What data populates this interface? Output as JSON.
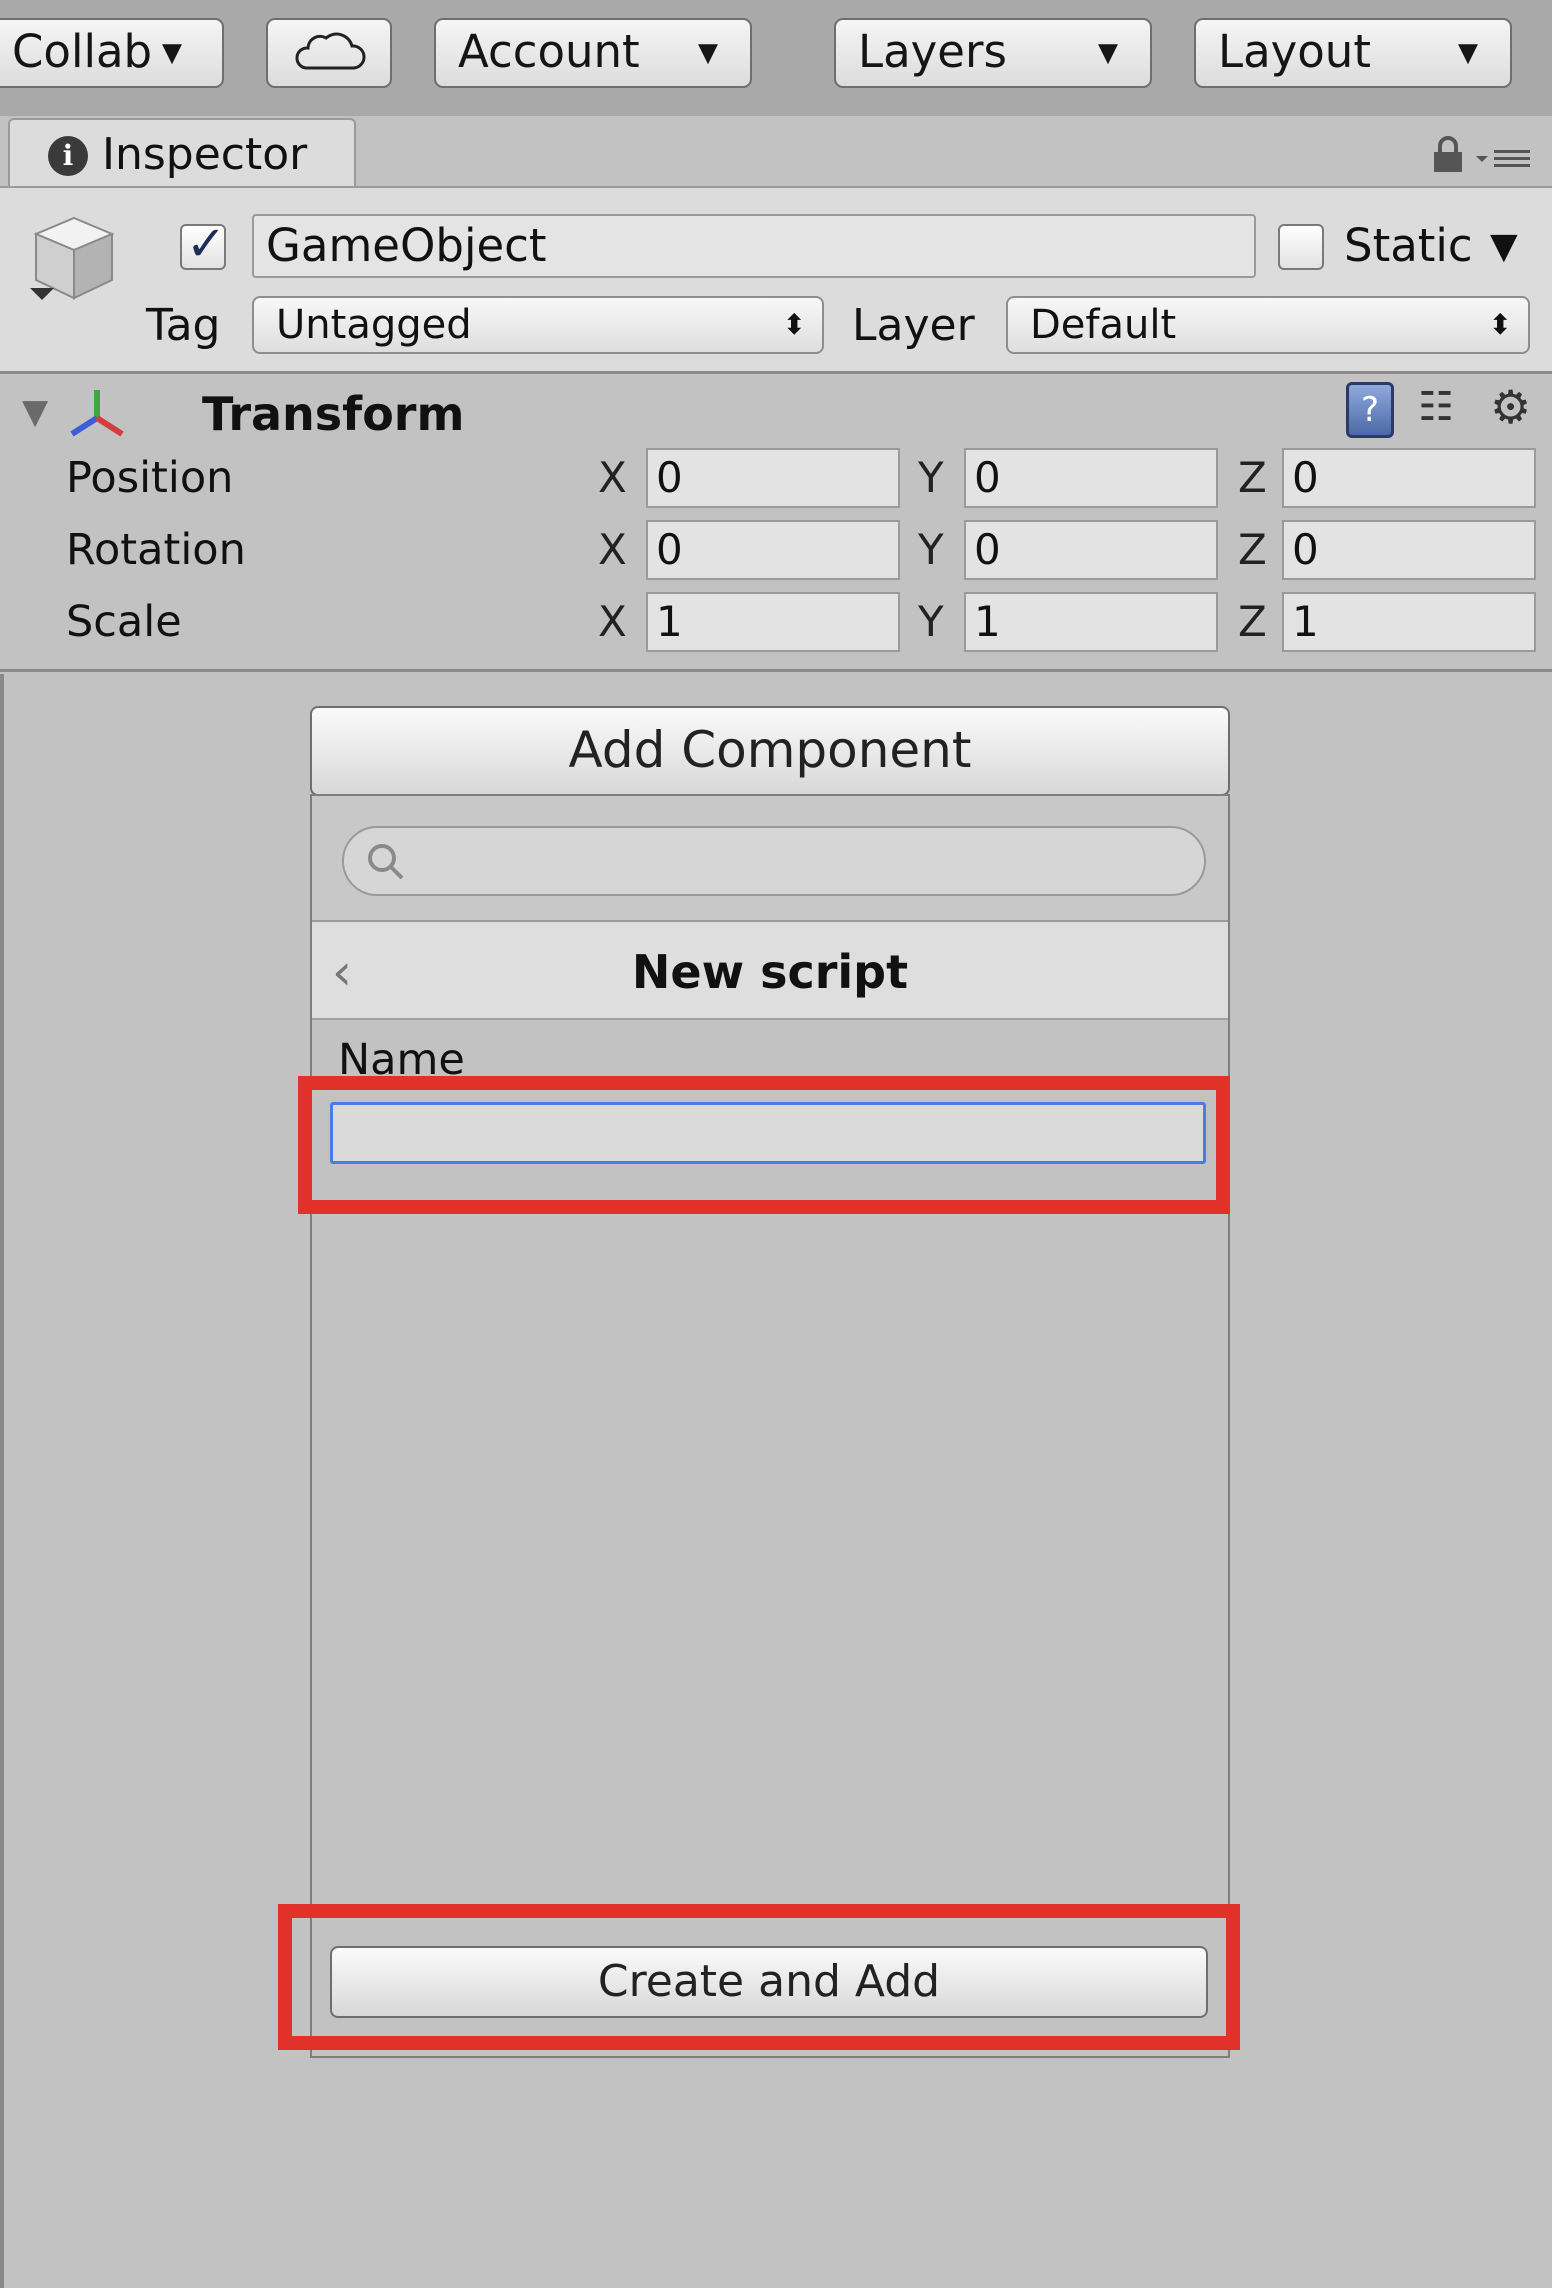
{
  "toolbar": {
    "collab_label": "Collab",
    "account_label": "Account",
    "layers_label": "Layers",
    "layout_label": "Layout"
  },
  "tab": {
    "label": "Inspector"
  },
  "header": {
    "object_name": "GameObject",
    "static_label": "Static",
    "tag_label": "Tag",
    "tag_value": "Untagged",
    "layer_label": "Layer",
    "layer_value": "Default"
  },
  "transform": {
    "title": "Transform",
    "rows": [
      {
        "label": "Position",
        "x": "0",
        "y": "0",
        "z": "0"
      },
      {
        "label": "Rotation",
        "x": "0",
        "y": "0",
        "z": "0"
      },
      {
        "label": "Scale",
        "x": "1",
        "y": "1",
        "z": "1"
      }
    ],
    "axes": [
      "X",
      "Y",
      "Z"
    ]
  },
  "add_component": {
    "button_label": "Add Component",
    "search_value": "",
    "panel_title": "New script",
    "name_label": "Name",
    "name_value": "",
    "create_label": "Create and Add"
  },
  "colors": {
    "highlight": "#e0312a",
    "focus": "#4a7ce6"
  }
}
